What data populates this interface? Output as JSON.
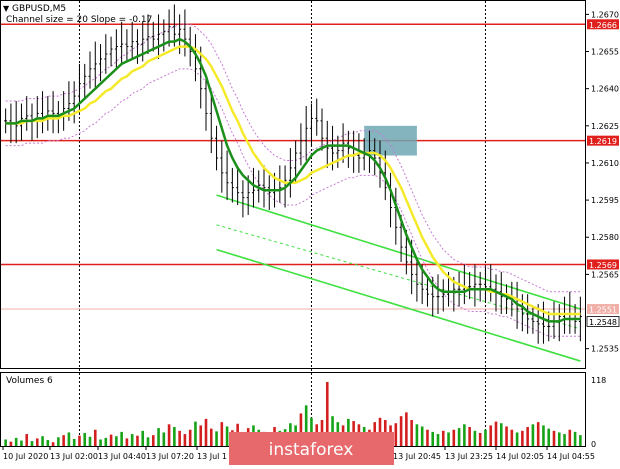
{
  "header": {
    "symbol": "GBPUSD,M5",
    "indicator": "Channel size = 20 Slope = -0.17"
  },
  "volume_label": "Volumes 6",
  "watermark": "instaforex",
  "colors": {
    "price": "#000000",
    "ma_fast": "#1a8f1a",
    "ma_slow": "#f5ea2a",
    "envelope": "#c879d6",
    "level": "#e0201d",
    "channel": "#3fe03f",
    "zone": "#6fa8b4",
    "vol_up": "#17a317",
    "vol_down": "#d41f1f",
    "watermark_bg": "#e8696c",
    "price_tag_bg": "#e0201d",
    "current_line": "#f0b0a8"
  },
  "chart_data": {
    "type": "line",
    "title": "GBPUSD,M5",
    "x_tick_labels": [
      "10 Jul 2020",
      "13 Jul 02:00",
      "13 Jul 04:40",
      "13 Jul 07:20",
      "13 Jul 1",
      "13 Jul 20:45",
      "13 Jul 23:25",
      "14 Jul 02:05",
      "14 Jul 04:55"
    ],
    "y_ticks": [
      1.267,
      1.2655,
      1.264,
      1.2625,
      1.261,
      1.2595,
      1.258,
      1.2565,
      1.2535
    ],
    "ylim": [
      1.2528,
      1.2675
    ],
    "levels": [
      {
        "label": "1.2666",
        "value": 1.2666
      },
      {
        "label": "1.2619",
        "value": 1.2619
      },
      {
        "label": "1.2569",
        "value": 1.2569
      }
    ],
    "current_price": {
      "label": "1.2548",
      "value": 1.2548
    },
    "price_marker": {
      "label": "1.2551",
      "value": 1.2551
    },
    "volume_ticks": [
      118,
      0
    ],
    "n_bars": 110,
    "price_close": [
      1.2627,
      1.2626,
      1.2625,
      1.2628,
      1.2629,
      1.2627,
      1.263,
      1.2628,
      1.2631,
      1.263,
      1.2629,
      1.2632,
      1.2634,
      1.2637,
      1.2642,
      1.2645,
      1.2648,
      1.265,
      1.2652,
      1.2654,
      1.2656,
      1.2657,
      1.2658,
      1.2657,
      1.2659,
      1.2658,
      1.266,
      1.2661,
      1.266,
      1.2662,
      1.2663,
      1.2665,
      1.2662,
      1.2664,
      1.266,
      1.2655,
      1.2648,
      1.264,
      1.263,
      1.262,
      1.2612,
      1.2606,
      1.2602,
      1.26,
      1.2598,
      1.2596,
      1.2598,
      1.2599,
      1.2601,
      1.26,
      1.2598,
      1.2599,
      1.26,
      1.2603,
      1.2608,
      1.2614,
      1.2619,
      1.2624,
      1.2628,
      1.2627,
      1.262,
      1.2616,
      1.2614,
      1.2615,
      1.2618,
      1.2616,
      1.2613,
      1.2612,
      1.2614,
      1.2615,
      1.2612,
      1.2606,
      1.26,
      1.2592,
      1.2584,
      1.2576,
      1.257,
      1.2565,
      1.2561,
      1.2559,
      1.2557,
      1.2556,
      1.2556,
      1.2557,
      1.2558,
      1.2559,
      1.2559,
      1.256,
      1.256,
      1.2561,
      1.2561,
      1.256,
      1.2559,
      1.2558,
      1.2556,
      1.2555,
      1.2553,
      1.2551,
      1.2549,
      1.2547,
      1.2546,
      1.2545,
      1.2544,
      1.2544,
      1.2546,
      1.2548,
      1.2549,
      1.2547,
      1.2546,
      1.2548
    ],
    "ma_fast": [
      1.2626,
      1.2626,
      1.2626,
      1.2627,
      1.2627,
      1.2627,
      1.2628,
      1.2628,
      1.2629,
      1.2629,
      1.2629,
      1.263,
      1.2631,
      1.2632,
      1.2634,
      1.2636,
      1.2638,
      1.264,
      1.2642,
      1.2644,
      1.2646,
      1.2648,
      1.265,
      1.2651,
      1.2652,
      1.2653,
      1.2654,
      1.2655,
      1.2656,
      1.2657,
      1.2658,
      1.2659,
      1.2659,
      1.266,
      1.2659,
      1.2657,
      1.2654,
      1.265,
      1.2645,
      1.2638,
      1.2631,
      1.2624,
      1.2617,
      1.2612,
      1.2608,
      1.2605,
      1.2603,
      1.2601,
      1.26,
      1.2599,
      1.2599,
      1.2599,
      1.2599,
      1.26,
      1.2602,
      1.2604,
      1.2607,
      1.261,
      1.2613,
      1.2615,
      1.2616,
      1.2617,
      1.2617,
      1.2617,
      1.2617,
      1.2617,
      1.2616,
      1.2615,
      1.2614,
      1.2613,
      1.2611,
      1.2608,
      1.2604,
      1.2599,
      1.2593,
      1.2587,
      1.2581,
      1.2576,
      1.2571,
      1.2567,
      1.2564,
      1.2561,
      1.2559,
      1.2558,
      1.2558,
      1.2558,
      1.2558,
      1.2558,
      1.2559,
      1.2559,
      1.2559,
      1.2559,
      1.2559,
      1.2558,
      1.2557,
      1.2556,
      1.2555,
      1.2553,
      1.2552,
      1.255,
      1.2549,
      1.2548,
      1.2547,
      1.2546,
      1.2546,
      1.2546,
      1.2547,
      1.2547,
      1.2547,
      1.2547
    ],
    "ma_slow": [
      1.2626,
      1.2626,
      1.2626,
      1.2626,
      1.2627,
      1.2627,
      1.2627,
      1.2627,
      1.2628,
      1.2628,
      1.2628,
      1.2629,
      1.2629,
      1.263,
      1.2631,
      1.2632,
      1.2634,
      1.2635,
      1.2637,
      1.2639,
      1.264,
      1.2642,
      1.2644,
      1.2645,
      1.2647,
      1.2648,
      1.2649,
      1.2651,
      1.2652,
      1.2653,
      1.2654,
      1.2655,
      1.2656,
      1.2657,
      1.2657,
      1.2657,
      1.2656,
      1.2654,
      1.2652,
      1.2649,
      1.2645,
      1.2641,
      1.2636,
      1.2631,
      1.2627,
      1.2622,
      1.2618,
      1.2614,
      1.2611,
      1.2608,
      1.2606,
      1.2604,
      1.2603,
      1.2602,
      1.2602,
      1.2602,
      1.2603,
      1.2604,
      1.2606,
      1.2607,
      1.2608,
      1.2609,
      1.261,
      1.2611,
      1.2612,
      1.2613,
      1.2613,
      1.2614,
      1.2614,
      1.2614,
      1.2614,
      1.2613,
      1.2611,
      1.2608,
      1.2604,
      1.26,
      1.2595,
      1.259,
      1.2585,
      1.258,
      1.2576,
      1.2572,
      1.2569,
      1.2566,
      1.2564,
      1.2562,
      1.2561,
      1.256,
      1.2559,
      1.2559,
      1.2559,
      1.2559,
      1.2558,
      1.2558,
      1.2557,
      1.2557,
      1.2556,
      1.2555,
      1.2554,
      1.2553,
      1.2552,
      1.2551,
      1.255,
      1.2549,
      1.2549,
      1.2549,
      1.2549,
      1.2549,
      1.2549,
      1.2549
    ],
    "envelope_width": 0.0009,
    "channel_lines": [
      {
        "from": [
          40,
          1.2597
        ],
        "to": [
          109,
          1.2551
        ]
      },
      {
        "from": [
          40,
          1.2585
        ],
        "to": [
          109,
          1.2543
        ]
      },
      {
        "from": [
          40,
          1.2575
        ],
        "to": [
          109,
          1.253
        ]
      }
    ],
    "zone": {
      "x0": 68,
      "x1": 78,
      "y0": 1.2613,
      "y1": 1.2625
    },
    "volume": [
      12,
      8,
      15,
      10,
      22,
      9,
      14,
      18,
      11,
      7,
      16,
      20,
      25,
      13,
      19,
      24,
      17,
      30,
      12,
      15,
      21,
      18,
      26,
      14,
      22,
      19,
      28,
      16,
      20,
      33,
      25,
      40,
      35,
      28,
      22,
      30,
      45,
      38,
      50,
      32,
      27,
      44,
      36,
      29,
      41,
      24,
      33,
      38,
      30,
      26,
      22,
      35,
      28,
      31,
      42,
      38,
      60,
      75,
      52,
      40,
      48,
      118,
      55,
      44,
      38,
      50,
      46,
      40,
      35,
      30,
      44,
      52,
      48,
      38,
      42,
      55,
      62,
      48,
      40,
      36,
      30,
      26,
      22,
      28,
      25,
      30,
      33,
      40,
      35,
      28,
      24,
      30,
      38,
      45,
      42,
      36,
      30,
      25,
      28,
      35,
      40,
      44,
      38,
      32,
      28,
      25,
      22,
      30,
      26,
      20
    ],
    "volume_up_mask": [
      1,
      0,
      1,
      1,
      0,
      1,
      0,
      1,
      1,
      0,
      1,
      0,
      1,
      1,
      0,
      1,
      1,
      0,
      1,
      1,
      0,
      1,
      1,
      0,
      1,
      0,
      1,
      1,
      0,
      1,
      1,
      0,
      1,
      0,
      0,
      0,
      1,
      0,
      0,
      0,
      1,
      0,
      1,
      0,
      0,
      1,
      0,
      1,
      1,
      0,
      1,
      0,
      1,
      1,
      1,
      1,
      0,
      1,
      1,
      0,
      0,
      0,
      1,
      1,
      0,
      1,
      0,
      0,
      1,
      0,
      0,
      0,
      0,
      0,
      0,
      0,
      0,
      0,
      1,
      1,
      0,
      1,
      1,
      0,
      1,
      0,
      1,
      1,
      0,
      1,
      0,
      1,
      0,
      0,
      1,
      0,
      0,
      1,
      0,
      0,
      1,
      0,
      1,
      1,
      0,
      1,
      1,
      0,
      1,
      1
    ]
  }
}
